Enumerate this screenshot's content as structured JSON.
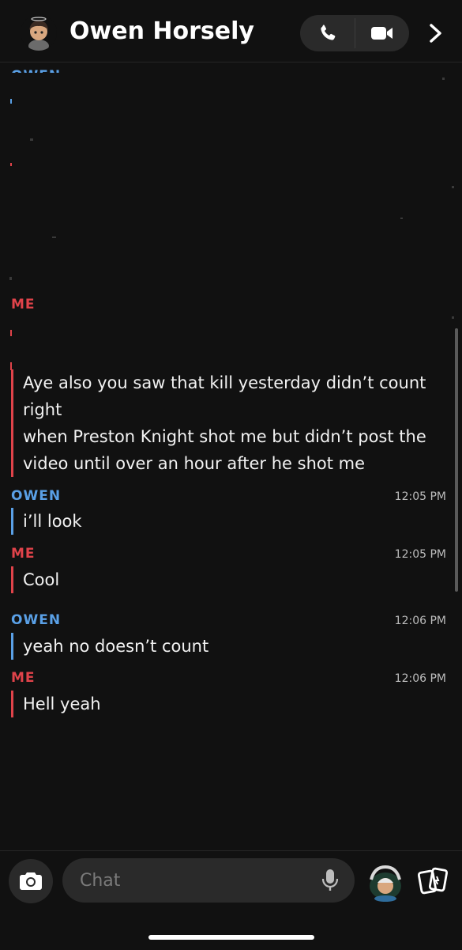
{
  "header": {
    "title": "Owen Horsely",
    "avatar_icon": "bitmoji-avatar-icon",
    "call_icon": "phone-icon",
    "video_icon": "video-camera-icon",
    "more_icon": "chevron-right-icon"
  },
  "colors": {
    "background": "#111111",
    "me": "#e0434a",
    "owen": "#5aa0e6",
    "input_bg": "#2a2a2a"
  },
  "chat": {
    "top_sender": "ME",
    "partial_text": "…",
    "first_message": {
      "lines": [
        "Aye also you saw that kill yesterday didn’t count",
        "right",
        "when Preston Knight shot me but didn’t post the",
        "video until over an hour after he shot me"
      ]
    },
    "messages": [
      {
        "sender": "OWEN",
        "time": "12:05 PM",
        "text": "i’ll look"
      },
      {
        "sender": "ME",
        "time": "12:05 PM",
        "text": "Cool"
      },
      {
        "sender": "OWEN",
        "time": "12:06 PM",
        "text": "yeah no doesn’t count"
      },
      {
        "sender": "ME",
        "time": "12:06 PM",
        "text": "Hell yeah"
      }
    ]
  },
  "composer": {
    "placeholder": "Chat",
    "camera_icon": "camera-icon",
    "mic_icon": "microphone-icon",
    "sticker_icon": "bitmoji-sticker-icon",
    "cards_icon": "cards-icon"
  }
}
